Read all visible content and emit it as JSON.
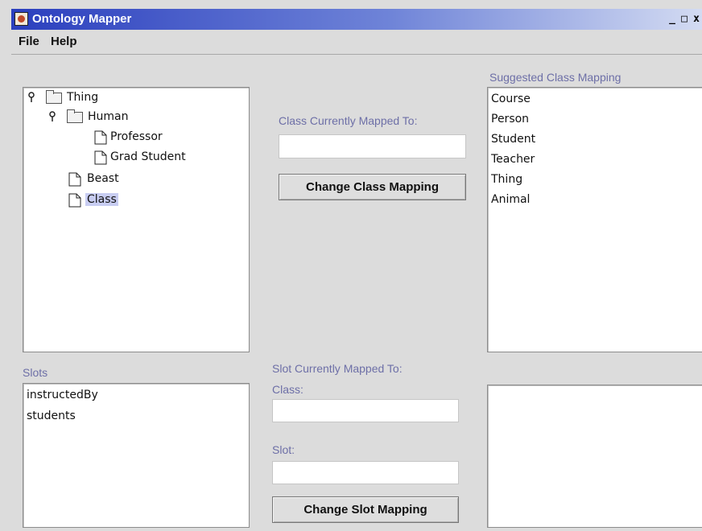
{
  "window": {
    "title": "Ontology Mapper",
    "buttons": [
      "_",
      "□",
      "x"
    ]
  },
  "menu": {
    "items": [
      "File",
      "Help"
    ]
  },
  "tree": {
    "nodes": [
      {
        "label": "Thing",
        "type": "folder",
        "expanded": true,
        "selected": false
      },
      {
        "label": "Human",
        "type": "folder",
        "expanded": true,
        "selected": false
      },
      {
        "label": "Professor",
        "type": "leaf",
        "selected": false
      },
      {
        "label": "Grad Student",
        "type": "leaf",
        "selected": false
      },
      {
        "label": "Beast",
        "type": "leaf",
        "selected": false
      },
      {
        "label": "Class",
        "type": "leaf",
        "selected": true
      }
    ]
  },
  "class_mapping": {
    "label": "Class Currently Mapped To:",
    "value": "",
    "button_label": "Change Class Mapping"
  },
  "suggested": {
    "label": "Suggested Class Mapping",
    "items": [
      "Course",
      "Person",
      "Student",
      "Teacher",
      "Thing",
      "Animal"
    ]
  },
  "slots": {
    "label": "Slots",
    "items": [
      "instructedBy",
      "students"
    ]
  },
  "slot_mapping": {
    "label": "Slot Currently Mapped To:",
    "class_label": "Class:",
    "class_value": "",
    "slot_label": "Slot:",
    "slot_value": "",
    "button_label": "Change Slot Mapping"
  },
  "suggested_slots": {
    "items": []
  }
}
